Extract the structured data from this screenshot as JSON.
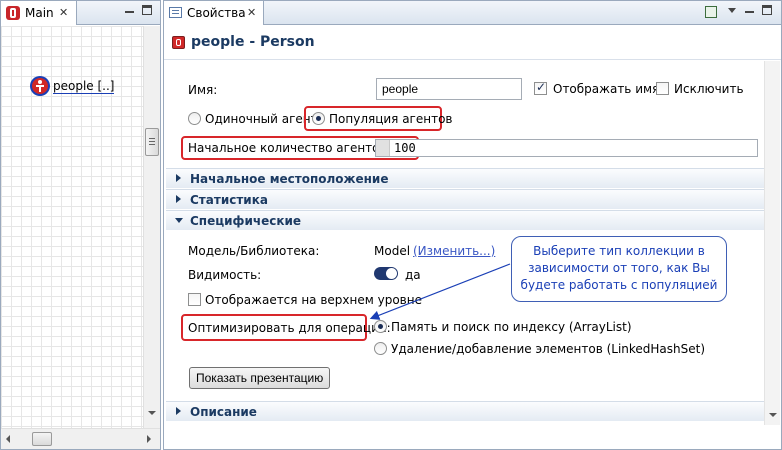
{
  "left_tab": {
    "title": "Main"
  },
  "left_canvas": {
    "agent_label": "people [..]"
  },
  "right_tab": {
    "title": "Свойства"
  },
  "header": {
    "title": "people - Person"
  },
  "form": {
    "name_label": "Имя:",
    "name_value": "people",
    "show_name_label": "Отображать имя",
    "show_name_checked": true,
    "exclude_label": "Исключить",
    "exclude_checked": false,
    "single_agent_label": "Одиночный агент",
    "population_label": "Популяция агентов",
    "selected_type": "population",
    "initial_count_label": "Начальное количество агентов:",
    "initial_count_value": "100"
  },
  "sections": {
    "initial_location": "Начальное местоположение",
    "statistics": "Статистика",
    "specific": "Специфические",
    "description": "Описание"
  },
  "specific": {
    "model_label": "Модель/Библиотека:",
    "model_value": "Model",
    "change_link": "(Изменить...)",
    "visibility_label": "Видимость:",
    "visibility_value": "да",
    "on_top_label": "Отображается на верхнем уровне",
    "on_top_checked": false,
    "optimize_label": "Оптимизировать для операции:",
    "option_arraylist": "Память и поиск по индексу (ArrayList)",
    "option_linkedhashset": "Удаление/добавление элементов (LinkedHashSet)",
    "selected_option": "arraylist",
    "show_presentation_button": "Показать презентацию"
  },
  "callout": {
    "line1": "Выберите тип коллекции в",
    "line2": "зависимости от того, как Вы",
    "line3": "будете работать с популяцией"
  },
  "colors": {
    "highlight_red": "#d8262a",
    "section_text": "#1b3a62",
    "callout_blue": "#1a3fb6",
    "link_blue": "#3a57c4"
  }
}
